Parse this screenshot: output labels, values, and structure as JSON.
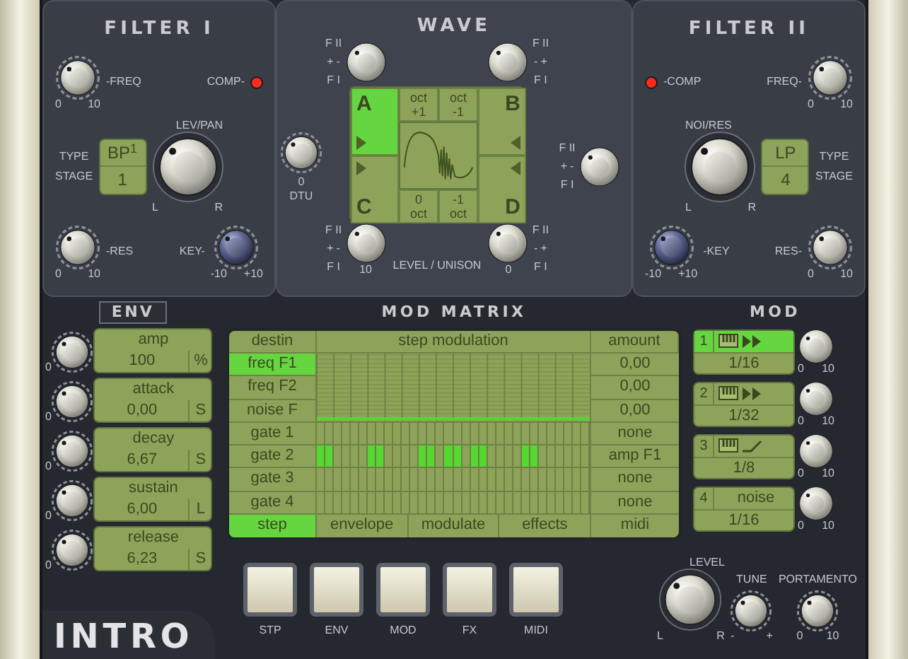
{
  "filter1": {
    "title": "FILTER I",
    "freq": {
      "label": "-FREQ",
      "min": "0",
      "max": "10"
    },
    "comp": {
      "label": "COMP-",
      "on": true
    },
    "type_label": "TYPE",
    "stage_label": "STAGE",
    "type": "BP$^{1}$",
    "stage": "1",
    "levpan": {
      "label": "LEV/PAN",
      "left": "L",
      "right": "R"
    },
    "res": {
      "label": "-RES",
      "min": "0",
      "max": "10"
    },
    "key": {
      "label": "KEY-",
      "min": "-10",
      "max": "+10"
    }
  },
  "wave": {
    "title": "WAVE",
    "dtu": {
      "scale": "0",
      "label": "DTU"
    },
    "knobs": [
      {
        "top": "F II",
        "plus": "+",
        "minus": "-",
        "bottom": "F I"
      },
      {
        "top": "F II",
        "plus": "+",
        "minus": "-",
        "bottom": "F I"
      },
      {
        "top": "F II",
        "plus": "+",
        "minus": "-",
        "bottom": "F I",
        "scale": "10"
      },
      {
        "top": "F II",
        "plus": "+",
        "minus": "-",
        "bottom": "F I",
        "scale": "0"
      }
    ],
    "side_knob": {
      "top": "F II",
      "plus": "+",
      "minus": "-",
      "bottom": "F I"
    },
    "oscillators": [
      {
        "letter": "A",
        "selected": true,
        "oct_label": "oct",
        "oct": "+1"
      },
      {
        "letter": "B",
        "selected": false,
        "oct_label": "oct",
        "oct": "-1"
      },
      {
        "letter": "C",
        "selected": false,
        "oct_label": "oct",
        "oct": "0"
      },
      {
        "letter": "D",
        "selected": false,
        "oct_label": "oct",
        "oct": "-1"
      }
    ],
    "bottom_label": "LEVEL / UNISON"
  },
  "filter2": {
    "title": "FILTER II",
    "freq": {
      "label": "FREQ-",
      "min": "0",
      "max": "10"
    },
    "comp": {
      "label": "-COMP",
      "on": true
    },
    "type_label": "TYPE",
    "stage_label": "STAGE",
    "type": "LP",
    "stage": "4",
    "levpan": {
      "label": "NOI/RES",
      "left": "L",
      "right": "R"
    },
    "res": {
      "label": "RES-",
      "min": "0",
      "max": "10"
    },
    "key": {
      "label": "-KEY",
      "min": "-10",
      "max": "+10"
    }
  },
  "env": {
    "title": "ENV",
    "items": [
      {
        "name": "amp",
        "value": "100",
        "unit": "%",
        "scale": "0"
      },
      {
        "name": "attack",
        "value": "0,00",
        "unit": "S",
        "scale": "0"
      },
      {
        "name": "decay",
        "value": "6,67",
        "unit": "S",
        "scale": "0"
      },
      {
        "name": "sustain",
        "value": "6,00",
        "unit": "L",
        "scale": "0"
      },
      {
        "name": "release",
        "value": "6,23",
        "unit": "S",
        "scale": "0"
      }
    ]
  },
  "logo": "INTRO",
  "matrix": {
    "title": "MOD MATRIX",
    "columns": [
      "destin",
      "step modulation",
      "amount"
    ],
    "rows": [
      {
        "kind": "curve",
        "label": "freq F1",
        "selected": true,
        "amount": "0,00"
      },
      {
        "kind": "curve",
        "label": "freq F2",
        "selected": false,
        "amount": "0,00"
      },
      {
        "kind": "curve",
        "label": "noise F",
        "selected": false,
        "amount": "0,00"
      },
      {
        "kind": "gate",
        "label": "gate 1",
        "selected": false,
        "amount": "none",
        "steps": [
          false,
          false,
          false,
          false,
          false,
          false,
          false,
          false,
          false,
          false,
          false,
          false,
          false,
          false,
          false,
          false,
          false,
          false,
          false,
          false,
          false,
          false,
          false,
          false,
          false,
          false,
          false,
          false,
          false,
          false,
          false,
          false
        ]
      },
      {
        "kind": "gate",
        "label": "gate 2",
        "selected": false,
        "amount": "amp F1",
        "steps": [
          true,
          true,
          false,
          false,
          false,
          false,
          true,
          true,
          false,
          false,
          false,
          false,
          true,
          true,
          false,
          true,
          true,
          false,
          true,
          true,
          false,
          false,
          false,
          false,
          true,
          true,
          false,
          false,
          false,
          false,
          false,
          false
        ]
      },
      {
        "kind": "gate",
        "label": "gate 3",
        "selected": false,
        "amount": "none",
        "steps": [
          false,
          false,
          false,
          false,
          false,
          false,
          false,
          false,
          false,
          false,
          false,
          false,
          false,
          false,
          false,
          false,
          false,
          false,
          false,
          false,
          false,
          false,
          false,
          false,
          false,
          false,
          false,
          false,
          false,
          false,
          false,
          false
        ]
      },
      {
        "kind": "gate",
        "label": "gate 4",
        "selected": false,
        "amount": "none",
        "steps": [
          false,
          false,
          false,
          false,
          false,
          false,
          false,
          false,
          false,
          false,
          false,
          false,
          false,
          false,
          false,
          false,
          false,
          false,
          false,
          false,
          false,
          false,
          false,
          false,
          false,
          false,
          false,
          false,
          false,
          false,
          false,
          false
        ]
      }
    ],
    "tabs": [
      {
        "label": "step",
        "selected": true
      },
      {
        "label": "envelope",
        "selected": false
      },
      {
        "label": "modulate",
        "selected": false
      },
      {
        "label": "effects",
        "selected": false
      },
      {
        "label": "midi",
        "selected": false
      }
    ]
  },
  "mod": {
    "title": "MOD",
    "items": [
      {
        "number": "1",
        "kind": "keys-forward",
        "selected": true,
        "value": "1/16",
        "min": "0",
        "max": "10"
      },
      {
        "number": "2",
        "kind": "keys-forward",
        "selected": false,
        "value": "1/32",
        "min": "0",
        "max": "10"
      },
      {
        "number": "3",
        "kind": "keys-ramp",
        "selected": false,
        "value": "1/8",
        "min": "0",
        "max": "10"
      },
      {
        "number": "4",
        "kind": "text",
        "label": "noise",
        "selected": false,
        "value": "1/16",
        "min": "0",
        "max": "10"
      }
    ]
  },
  "pages": [
    "STP",
    "ENV",
    "MOD",
    "FX",
    "MIDI"
  ],
  "master": {
    "level": {
      "label": "LEVEL",
      "left": "L",
      "right": "R"
    },
    "tune": {
      "label": "TUNE",
      "min": "-",
      "max": "+"
    },
    "portamento": {
      "label": "PORTAMENTO",
      "min": "0",
      "max": "10"
    }
  }
}
